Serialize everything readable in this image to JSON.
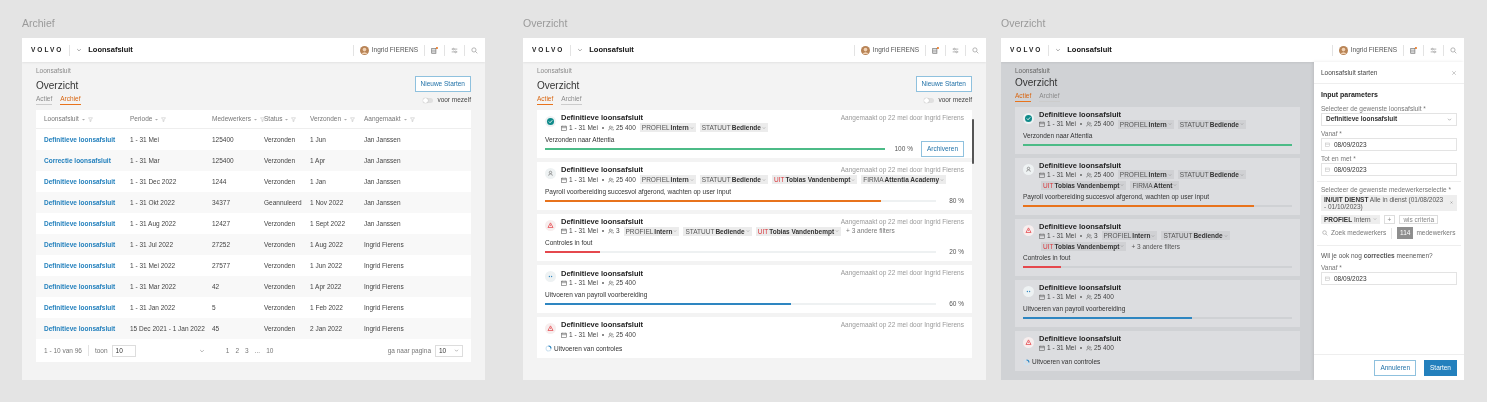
{
  "archive_view": {
    "caption": "Archief",
    "header": {
      "logo": "VOLVO",
      "title": "Loonsafsluit",
      "user": "Ingrid FIERENS"
    },
    "breadcrumb": "Loonsafsluit",
    "heading": "Overzicht",
    "new_button": "Nieuwe Starten",
    "tabs": [
      {
        "label": "Actief",
        "selected": false
      },
      {
        "label": "Archief",
        "selected": true
      }
    ],
    "toggle": {
      "label": "voor mezelf",
      "on": false
    },
    "table": {
      "columns": [
        "Loonsafsluit",
        "Periode",
        "Medewerkers",
        "Status",
        "Verzonden",
        "Aangemaakt"
      ],
      "rows": [
        [
          "Definitieve loonsafsluit",
          "1 - 31 Mei",
          "125400",
          "Verzonden",
          "1 Jun",
          "Jan Janssen"
        ],
        [
          "Correctie loonsafsluit",
          "1 - 31 Mar",
          "125400",
          "Verzonden",
          "1 Apr",
          "Jan Janssen"
        ],
        [
          "Definitieve loonsafsluit",
          "1 - 31 Dec 2022",
          "1244",
          "Verzonden",
          "1 Jan",
          "Jan Janssen"
        ],
        [
          "Definitieve loonsafsluit",
          "1 - 31 Okt 2022",
          "34377",
          "Geannuleerd",
          "1 Nov 2022",
          "Jan Janssen"
        ],
        [
          "Definitieve loonsafsluit",
          "1 - 31 Aug 2022",
          "12427",
          "Verzonden",
          "1 Sept 2022",
          "Jan Janssen"
        ],
        [
          "Definitieve loonsafsluit",
          "1 - 31 Jul 2022",
          "27252",
          "Verzonden",
          "1 Aug 2022",
          "Ingrid Fierens"
        ],
        [
          "Definitieve loonsafsluit",
          "1 - 31 Mei 2022",
          "27577",
          "Verzonden",
          "1 Jun 2022",
          "Ingrid Fierens"
        ],
        [
          "Definitieve loonsafsluit",
          "1 - 31 Mar 2022",
          "42",
          "Verzonden",
          "1 Apr 2022",
          "Ingrid Fierens"
        ],
        [
          "Definitieve loonsafsluit",
          "1 - 31 Jan 2022",
          "5",
          "Verzonden",
          "1 Feb 2022",
          "Ingrid Fierens"
        ],
        [
          "Definitieve loonsafsluit",
          "15 Dec 2021 - 1 Jan 2022",
          "45",
          "Verzonden",
          "2 Jan 2022",
          "Ingrid Fierens"
        ]
      ]
    },
    "pagination": {
      "range": "1 - 10 van 96",
      "show_label": "toon",
      "page_size": "10",
      "pages": [
        "1",
        "2",
        "3",
        "...",
        "10"
      ],
      "goto_label": "ga naar pagina",
      "goto_value": "10"
    }
  },
  "overview_view": {
    "caption": "Overzicht",
    "header": {
      "logo": "VOLVO",
      "title": "Loonsafsluit",
      "user": "Ingrid FIERENS"
    },
    "breadcrumb": "Loonsafsluit",
    "heading": "Overzicht",
    "new_button": "Nieuwe Starten",
    "tabs": [
      {
        "label": "Actief",
        "selected": true
      },
      {
        "label": "Archief",
        "selected": false
      }
    ],
    "toggle": {
      "label": "voor mezelf",
      "on": false
    },
    "cards": [
      {
        "kind": "done",
        "title": "Definitieve loonsafsluit",
        "period": "1 - 31 Mei",
        "count": "25 400",
        "chips": [
          {
            "prefix": "PROFIEL",
            "value": "Intern",
            "negative": false
          },
          {
            "prefix": "STATUUT",
            "value": "Bediende",
            "negative": false
          }
        ],
        "created": "Aangemaakt op 22 mei door Ingrid Fierens",
        "progress": {
          "label": "Verzonden naar Attentia",
          "level": 1,
          "reading": "100 %",
          "color": "#4cbb87"
        },
        "action": "Archiveren"
      },
      {
        "kind": "waiting",
        "title": "Definitieve loonsafsluit",
        "period": "1 - 31 Mei",
        "count": "25 400",
        "chips": [
          {
            "prefix": "PROFIEL",
            "value": "Intern",
            "negative": false
          },
          {
            "prefix": "STATUUT",
            "value": "Bediende",
            "negative": false
          },
          {
            "prefix": "UIT",
            "value": "Tobias Vandenbempt",
            "negative": true
          },
          {
            "prefix": "FIRMA",
            "value": "Attentia Academy",
            "negative": false
          }
        ],
        "created": "Aangemaakt op 22 mei door Ingrid Fierens",
        "progress": {
          "label": "Payroll voorbereiding succesvol afgerond, wachten op user input",
          "level": 0.86,
          "reading": "80 %",
          "color": "#e8731c"
        }
      },
      {
        "kind": "error",
        "title": "Definitieve loonsafsluit",
        "period": "1 - 31 Mei",
        "count": "3",
        "chips": [
          {
            "prefix": "PROFIEL",
            "value": "Intern",
            "negative": false
          },
          {
            "prefix": "STATUUT",
            "value": "Bediende",
            "negative": false
          },
          {
            "prefix": "UIT",
            "value": "Tobias Vandenbempt",
            "negative": true
          }
        ],
        "more": "+ 3 andere filters",
        "created": "Aangemaakt op 22 mei door Ingrid Fierens",
        "progress": {
          "label": "Controles in fout",
          "level": 0.14,
          "reading": "20 %",
          "color": "#e5484d"
        }
      },
      {
        "kind": "running",
        "title": "Definitieve loonsafsluit",
        "period": "1 - 31 Mei",
        "count": "25 400",
        "created": "Aangemaakt op 22 mei door Ingrid Fierens",
        "progress": {
          "label": "Uitvoeren van payroll voorbereiding",
          "level": 0.63,
          "reading": "60 %",
          "color": "#2e86c1"
        }
      },
      {
        "kind": "error",
        "title": "Definitieve loonsafsluit",
        "period": "1 - 31 Mei",
        "count": "25 400",
        "created": "Aangemaakt op 22 mei door Ingrid Fierens",
        "task": "Uitvoeren van controles"
      }
    ]
  },
  "start_view": {
    "caption": "Overzicht",
    "header": {
      "logo": "VOLVO",
      "title": "Loonsafsluit",
      "user": "Ingrid FIERENS"
    },
    "breadcrumb": "Loonsafsluit",
    "heading": "Overzicht",
    "tabs": [
      {
        "label": "Actief",
        "selected": true
      },
      {
        "label": "Archief",
        "selected": false
      }
    ],
    "cards": [
      {
        "kind": "done",
        "title": "Definitieve loonsafsluit",
        "period": "1 - 31 Mei",
        "count": "25 400",
        "chips": [
          {
            "prefix": "PROFIEL",
            "value": "Intern",
            "negative": false
          },
          {
            "prefix": "STATUUT",
            "value": "Bediende",
            "negative": false
          }
        ],
        "progress": {
          "label": "Verzonden naar Attentia",
          "level": 1,
          "color": "#4cbb87"
        }
      },
      {
        "kind": "waiting",
        "title": "Definitieve loonsafsluit",
        "period": "1 - 31 Mei",
        "count": "25 400",
        "chips": [
          {
            "prefix": "PROFIEL",
            "value": "Intern",
            "negative": false
          },
          {
            "prefix": "STATUUT",
            "value": "Bediende",
            "negative": false
          },
          {
            "prefix": "UIT",
            "value": "Tobias Vandenbempt",
            "negative": true
          },
          {
            "prefix": "FIRMA",
            "value": "Attent",
            "negative": false
          }
        ],
        "progress": {
          "label": "Payroll voorbereiding succesvol afgerond, wachten op user input",
          "level": 0.86,
          "color": "#e8731c"
        }
      },
      {
        "kind": "error",
        "title": "Definitieve loonsafsluit",
        "period": "1 - 31 Mei",
        "count": "3",
        "chips": [
          {
            "prefix": "PROFIEL",
            "value": "Intern",
            "negative": false
          },
          {
            "prefix": "STATUUT",
            "value": "Bediende",
            "negative": false
          },
          {
            "prefix": "UIT",
            "value": "Tobias Vandenbempt",
            "negative": true
          }
        ],
        "more": "+ 3 andere filters",
        "progress": {
          "label": "Controles in fout",
          "level": 0.14,
          "color": "#e5484d"
        }
      },
      {
        "kind": "running",
        "title": "Definitieve loonsafsluit",
        "period": "1 - 31 Mei",
        "count": "25 400",
        "progress": {
          "label": "Uitvoeren van payroll voorbereiding",
          "level": 0.63,
          "color": "#2e86c1"
        }
      },
      {
        "kind": "error",
        "title": "Definitieve loonsafsluit",
        "period": "1 - 31 Mei",
        "count": "25 400",
        "task": "Uitvoeren van controles"
      }
    ],
    "drawer": {
      "title": "Loonsafsluit starten",
      "section": "Input parameters",
      "fields": [
        {
          "kind": "select",
          "label": "Selecteer de gewenste loonsafsluit *",
          "value": "Definitieve loonsafsluit"
        },
        {
          "kind": "date",
          "label": "Vanaf *",
          "value": "08/09/2023"
        },
        {
          "kind": "date",
          "label": "Tot en met *",
          "value": "08/09/2023"
        }
      ],
      "selection": {
        "label": "Selecteer de gewenste medewerkerselectie *",
        "chips": [
          {
            "kind": "removable",
            "prefix": "IN/UIT DIENST",
            "value": "Alle in dienst (01/08/2023 - 01/10/2023)"
          },
          {
            "kind": "dropdown",
            "prefix": "PROFIEL",
            "value": "Intern"
          }
        ],
        "add": "+",
        "clear": "wis criteria",
        "search_placeholder": "Zoek medewerkers",
        "count": "114",
        "count_label": "medewerkers"
      },
      "question": "Wil je ook nog **correcties** meenemen?",
      "correction_fields": [
        {
          "kind": "date",
          "label": "Vanaf *",
          "value": "08/09/2023"
        }
      ],
      "buttons": [
        {
          "kind": "secondary",
          "label": "Annuleren"
        },
        {
          "kind": "primary",
          "label": "Starten"
        }
      ]
    }
  }
}
